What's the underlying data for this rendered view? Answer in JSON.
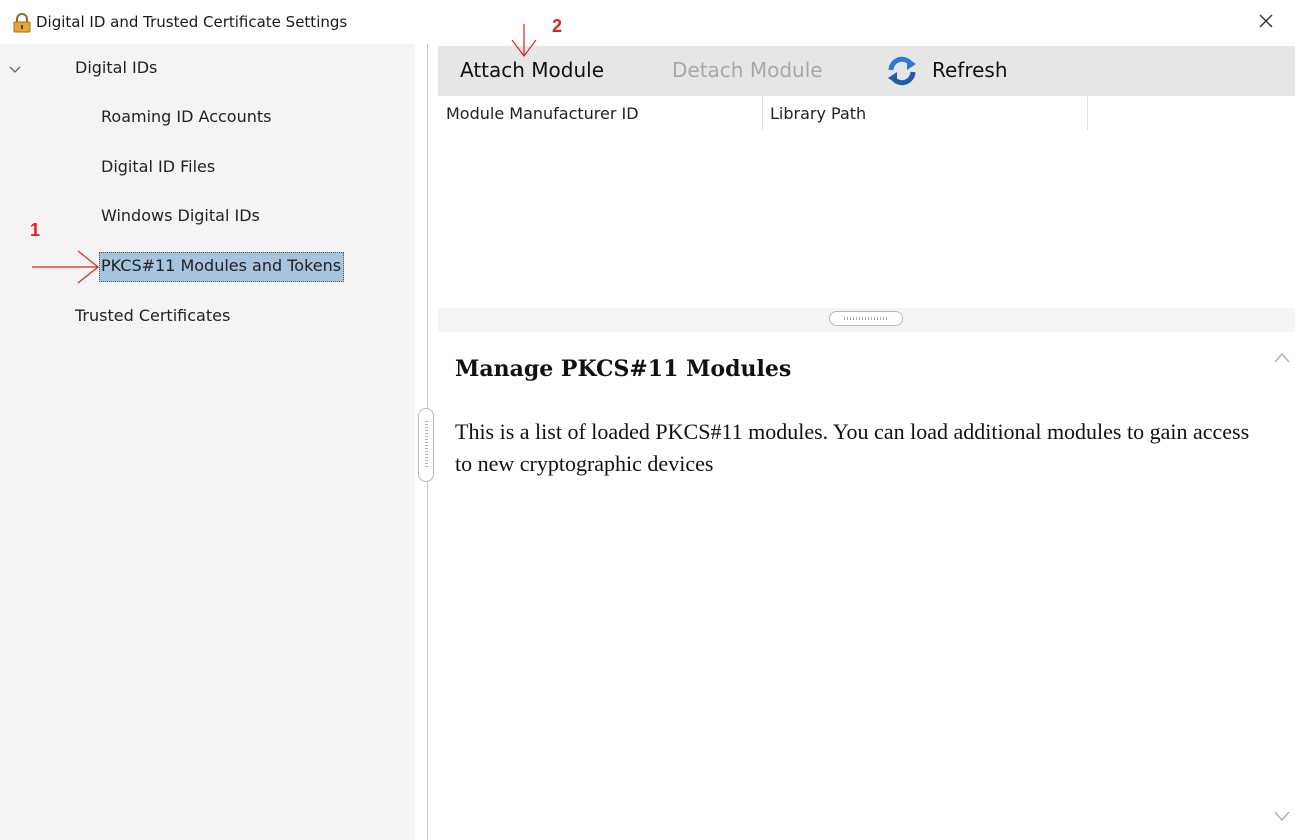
{
  "window": {
    "title": "Digital ID and Trusted Certificate Settings"
  },
  "tree": {
    "digital_ids": "Digital IDs",
    "roaming": "Roaming ID Accounts",
    "files": "Digital ID Files",
    "windows": "Windows Digital IDs",
    "pkcs": "PKCS#11 Modules and Tokens",
    "trusted": "Trusted Certificates"
  },
  "toolbar": {
    "attach": "Attach Module",
    "detach": "Detach Module",
    "refresh": "Refresh"
  },
  "table": {
    "columns": [
      "Module Manufacturer ID",
      "Library Path"
    ]
  },
  "description": {
    "title": "Manage PKCS#11 Modules",
    "body": "This is a list of loaded PKCS#11 modules. You can load additional modules to gain access to new cryptographic devices"
  },
  "annotations": {
    "step1": "1",
    "step2": "2"
  },
  "colors": {
    "selection": "#a6c4de",
    "annotation": "#e02020",
    "toolbar_bg": "#e6e6e6"
  }
}
